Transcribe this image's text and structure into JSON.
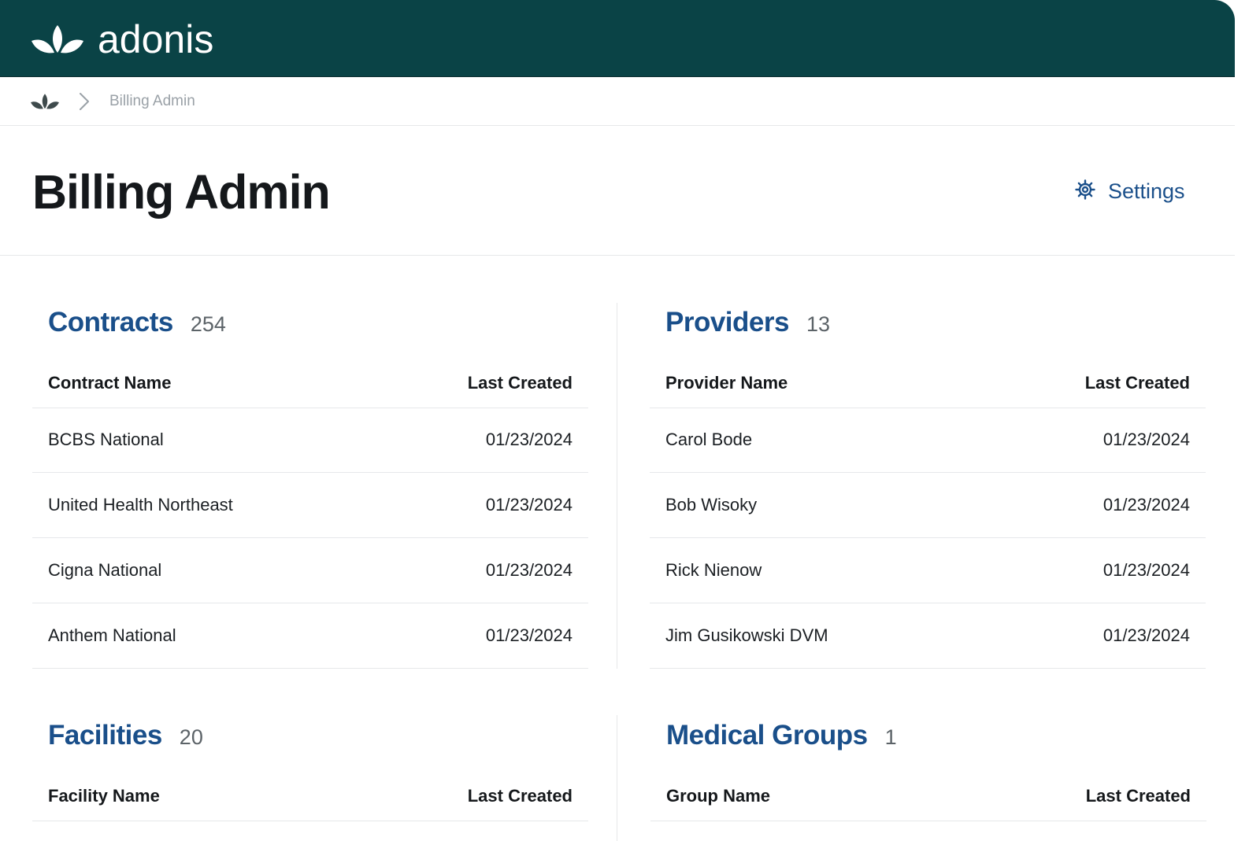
{
  "header": {
    "brand": "adonis",
    "logo_icon": "adonis-leaf-logo-icon",
    "bg_color": "#0a4346"
  },
  "breadcrumb": {
    "home_icon": "adonis-leaf-home-icon",
    "separator_icon": "chevron-right-icon",
    "current": "Billing Admin"
  },
  "page": {
    "title": "Billing Admin",
    "settings_label": "Settings",
    "settings_icon": "gear-icon",
    "accent_color": "#1a4f8a"
  },
  "contracts": {
    "title": "Contracts",
    "count": "254",
    "col_name": "Contract Name",
    "col_date": "Last Created",
    "rows": [
      {
        "name": "BCBS National",
        "date": "01/23/2024"
      },
      {
        "name": "United Health Northeast",
        "date": "01/23/2024"
      },
      {
        "name": "Cigna National",
        "date": "01/23/2024"
      },
      {
        "name": "Anthem National",
        "date": "01/23/2024"
      }
    ]
  },
  "providers": {
    "title": "Providers",
    "count": "13",
    "col_name": "Provider Name",
    "col_date": "Last Created",
    "rows": [
      {
        "name": "Carol Bode",
        "date": "01/23/2024"
      },
      {
        "name": "Bob Wisoky",
        "date": "01/23/2024"
      },
      {
        "name": "Rick Nienow",
        "date": "01/23/2024"
      },
      {
        "name": "Jim Gusikowski DVM",
        "date": "01/23/2024"
      }
    ]
  },
  "facilities": {
    "title": "Facilities",
    "count": "20",
    "col_name": "Facility Name",
    "col_date": "Last Created"
  },
  "medical_groups": {
    "title": "Medical Groups",
    "count": "1",
    "col_name": "Group Name",
    "col_date": "Last Created"
  }
}
